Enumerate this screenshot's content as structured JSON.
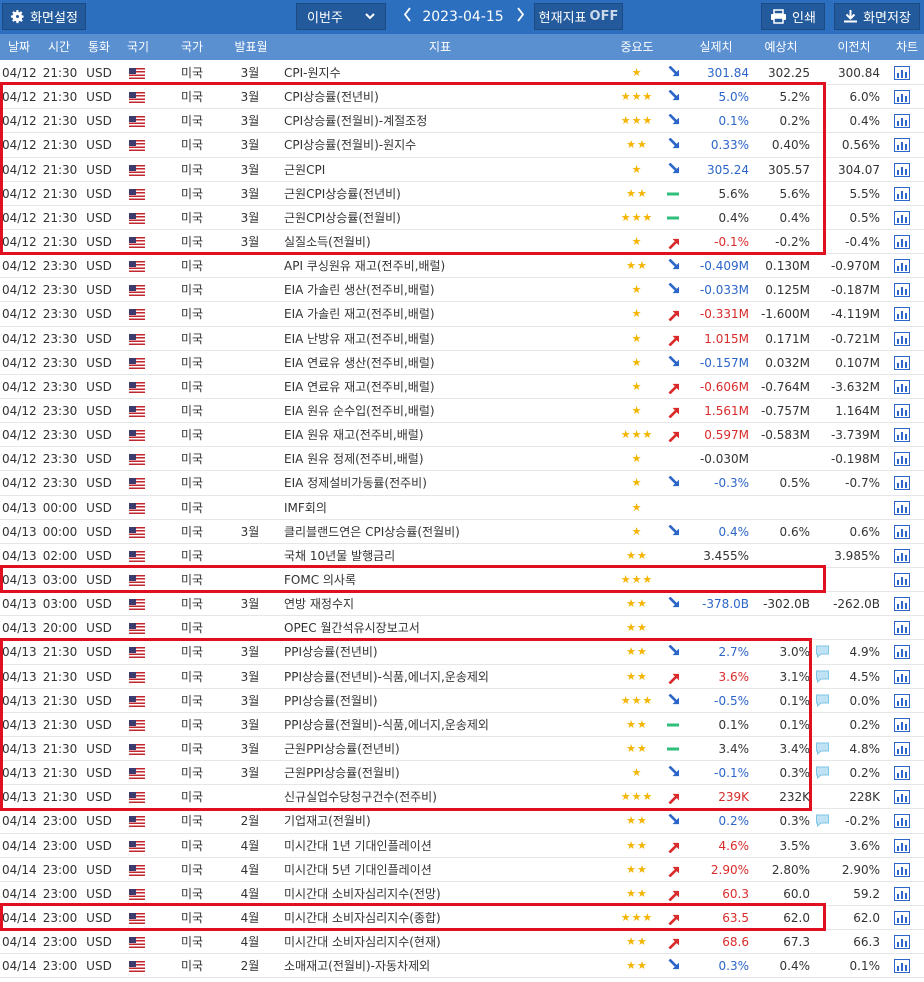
{
  "toolbar": {
    "settings_label": "화면설정",
    "week_select": "이번주",
    "date": "2023-04-15",
    "indicator_label": "현재지표",
    "indicator_state": "OFF",
    "print_label": "인쇄",
    "save_label": "화면저장"
  },
  "columns": [
    "날짜",
    "시간",
    "통화",
    "국기",
    "국가",
    "발표월",
    "지표",
    "중요도",
    "실제치",
    "예상치",
    "이전치",
    "차트"
  ],
  "colors": {
    "toolbar": "#2c6fbf",
    "header": "#5a8fd0",
    "up": "#d92b2b",
    "down": "#2c66c8",
    "flat": "#2fbf7a",
    "highlight": "#e01020",
    "star": "#f4b400"
  },
  "rows": [
    {
      "date": "04/12",
      "time": "21:30",
      "currency": "USD",
      "country": "미국",
      "month": "3월",
      "name": "CPI-원지수",
      "stars": "★",
      "trend": "down",
      "actual": "301.84",
      "actual_dir": "down",
      "forecast": "302.25",
      "previous": "300.84",
      "comment": false
    },
    {
      "date": "04/12",
      "time": "21:30",
      "currency": "USD",
      "country": "미국",
      "month": "3월",
      "name": "CPI상승률(전년비)",
      "stars": "★★★",
      "trend": "down",
      "actual": "5.0%",
      "actual_dir": "down",
      "forecast": "5.2%",
      "previous": "6.0%",
      "comment": false
    },
    {
      "date": "04/12",
      "time": "21:30",
      "currency": "USD",
      "country": "미국",
      "month": "3월",
      "name": "CPI상승률(전월비)-계절조정",
      "stars": "★★★",
      "trend": "down",
      "actual": "0.1%",
      "actual_dir": "down",
      "forecast": "0.2%",
      "previous": "0.4%",
      "comment": false
    },
    {
      "date": "04/12",
      "time": "21:30",
      "currency": "USD",
      "country": "미국",
      "month": "3월",
      "name": "CPI상승률(전월비)-원지수",
      "stars": "★★",
      "trend": "down",
      "actual": "0.33%",
      "actual_dir": "down",
      "forecast": "0.40%",
      "previous": "0.56%",
      "comment": false
    },
    {
      "date": "04/12",
      "time": "21:30",
      "currency": "USD",
      "country": "미국",
      "month": "3월",
      "name": "근원CPI",
      "stars": "★",
      "trend": "down",
      "actual": "305.24",
      "actual_dir": "down",
      "forecast": "305.57",
      "previous": "304.07",
      "comment": false
    },
    {
      "date": "04/12",
      "time": "21:30",
      "currency": "USD",
      "country": "미국",
      "month": "3월",
      "name": "근원CPI상승률(전년비)",
      "stars": "★★",
      "trend": "flat",
      "actual": "5.6%",
      "actual_dir": "flat",
      "forecast": "5.6%",
      "previous": "5.5%",
      "comment": false
    },
    {
      "date": "04/12",
      "time": "21:30",
      "currency": "USD",
      "country": "미국",
      "month": "3월",
      "name": "근원CPI상승률(전월비)",
      "stars": "★★★",
      "trend": "flat",
      "actual": "0.4%",
      "actual_dir": "flat",
      "forecast": "0.4%",
      "previous": "0.5%",
      "comment": false
    },
    {
      "date": "04/12",
      "time": "21:30",
      "currency": "USD",
      "country": "미국",
      "month": "3월",
      "name": "실질소득(전월비)",
      "stars": "★",
      "trend": "up",
      "actual": "-0.1%",
      "actual_dir": "up",
      "forecast": "-0.2%",
      "previous": "-0.4%",
      "comment": false
    },
    {
      "date": "04/12",
      "time": "23:30",
      "currency": "USD",
      "country": "미국",
      "month": "",
      "name": "API 쿠싱원유 재고(전주비,배럴)",
      "stars": "★★",
      "trend": "down",
      "actual": "-0.409M",
      "actual_dir": "down",
      "forecast": "0.130M",
      "previous": "-0.970M",
      "comment": false
    },
    {
      "date": "04/12",
      "time": "23:30",
      "currency": "USD",
      "country": "미국",
      "month": "",
      "name": "EIA 가솔린 생산(전주비,배럴)",
      "stars": "★",
      "trend": "down",
      "actual": "-0.033M",
      "actual_dir": "down",
      "forecast": "0.125M",
      "previous": "-0.187M",
      "comment": false
    },
    {
      "date": "04/12",
      "time": "23:30",
      "currency": "USD",
      "country": "미국",
      "month": "",
      "name": "EIA 가솔린 재고(전주비,배럴)",
      "stars": "★",
      "trend": "up",
      "actual": "-0.331M",
      "actual_dir": "up",
      "forecast": "-1.600M",
      "previous": "-4.119M",
      "comment": false
    },
    {
      "date": "04/12",
      "time": "23:30",
      "currency": "USD",
      "country": "미국",
      "month": "",
      "name": "EIA 난방유 재고(전주비,배럴)",
      "stars": "★",
      "trend": "up",
      "actual": "1.015M",
      "actual_dir": "up",
      "forecast": "0.171M",
      "previous": "-0.721M",
      "comment": false
    },
    {
      "date": "04/12",
      "time": "23:30",
      "currency": "USD",
      "country": "미국",
      "month": "",
      "name": "EIA 연료유 생산(전주비,배럴)",
      "stars": "★",
      "trend": "down",
      "actual": "-0.157M",
      "actual_dir": "down",
      "forecast": "0.032M",
      "previous": "0.107M",
      "comment": false
    },
    {
      "date": "04/12",
      "time": "23:30",
      "currency": "USD",
      "country": "미국",
      "month": "",
      "name": "EIA 연료유 재고(전주비,배럴)",
      "stars": "★",
      "trend": "up",
      "actual": "-0.606M",
      "actual_dir": "up",
      "forecast": "-0.764M",
      "previous": "-3.632M",
      "comment": false
    },
    {
      "date": "04/12",
      "time": "23:30",
      "currency": "USD",
      "country": "미국",
      "month": "",
      "name": "EIA 원유 순수입(전주비,배럴)",
      "stars": "★",
      "trend": "up",
      "actual": "1.561M",
      "actual_dir": "up",
      "forecast": "-0.757M",
      "previous": "1.164M",
      "comment": false
    },
    {
      "date": "04/12",
      "time": "23:30",
      "currency": "USD",
      "country": "미국",
      "month": "",
      "name": "EIA 원유 재고(전주비,배럴)",
      "stars": "★★★",
      "trend": "up",
      "actual": "0.597M",
      "actual_dir": "up",
      "forecast": "-0.583M",
      "previous": "-3.739M",
      "comment": false
    },
    {
      "date": "04/12",
      "time": "23:30",
      "currency": "USD",
      "country": "미국",
      "month": "",
      "name": "EIA 원유 정제(전주비,배럴)",
      "stars": "★",
      "trend": "",
      "actual": "-0.030M",
      "actual_dir": "flat",
      "forecast": "",
      "previous": "-0.198M",
      "comment": false
    },
    {
      "date": "04/12",
      "time": "23:30",
      "currency": "USD",
      "country": "미국",
      "month": "",
      "name": "EIA 정제설비가동률(전주비)",
      "stars": "★",
      "trend": "down",
      "actual": "-0.3%",
      "actual_dir": "down",
      "forecast": "0.5%",
      "previous": "-0.7%",
      "comment": false
    },
    {
      "date": "04/13",
      "time": "00:00",
      "currency": "USD",
      "country": "미국",
      "month": "",
      "name": "IMF회의",
      "stars": "★",
      "trend": "",
      "actual": "",
      "actual_dir": "flat",
      "forecast": "",
      "previous": "",
      "comment": false
    },
    {
      "date": "04/13",
      "time": "00:00",
      "currency": "USD",
      "country": "미국",
      "month": "3월",
      "name": "클리블랜드연은 CPI상승률(전월비)",
      "stars": "★",
      "trend": "down",
      "actual": "0.4%",
      "actual_dir": "down",
      "forecast": "0.6%",
      "previous": "0.6%",
      "comment": false
    },
    {
      "date": "04/13",
      "time": "02:00",
      "currency": "USD",
      "country": "미국",
      "month": "",
      "name": "국채 10년물 발행금리",
      "stars": "★★",
      "trend": "",
      "actual": "3.455%",
      "actual_dir": "flat",
      "forecast": "",
      "previous": "3.985%",
      "comment": false
    },
    {
      "date": "04/13",
      "time": "03:00",
      "currency": "USD",
      "country": "미국",
      "month": "",
      "name": "FOMC 의사록",
      "stars": "★★★",
      "trend": "",
      "actual": "",
      "actual_dir": "flat",
      "forecast": "",
      "previous": "",
      "comment": false
    },
    {
      "date": "04/13",
      "time": "03:00",
      "currency": "USD",
      "country": "미국",
      "month": "3월",
      "name": "연방 재정수지",
      "stars": "★★",
      "trend": "down",
      "actual": "-378.0B",
      "actual_dir": "down",
      "forecast": "-302.0B",
      "previous": "-262.0B",
      "comment": false
    },
    {
      "date": "04/13",
      "time": "20:00",
      "currency": "USD",
      "country": "미국",
      "month": "",
      "name": "OPEC 월간석유시장보고서",
      "stars": "★★",
      "trend": "",
      "actual": "",
      "actual_dir": "flat",
      "forecast": "",
      "previous": "",
      "comment": false
    },
    {
      "date": "04/13",
      "time": "21:30",
      "currency": "USD",
      "country": "미국",
      "month": "3월",
      "name": "PPI상승률(전년비)",
      "stars": "★★",
      "trend": "down",
      "actual": "2.7%",
      "actual_dir": "down",
      "forecast": "3.0%",
      "previous": "4.9%",
      "comment": true
    },
    {
      "date": "04/13",
      "time": "21:30",
      "currency": "USD",
      "country": "미국",
      "month": "3월",
      "name": "PPI상승률(전년비)-식품,에너지,운송제외",
      "stars": "★★",
      "trend": "up",
      "actual": "3.6%",
      "actual_dir": "up",
      "forecast": "3.1%",
      "previous": "4.5%",
      "comment": true
    },
    {
      "date": "04/13",
      "time": "21:30",
      "currency": "USD",
      "country": "미국",
      "month": "3월",
      "name": "PPI상승률(전월비)",
      "stars": "★★★",
      "trend": "down",
      "actual": "-0.5%",
      "actual_dir": "down",
      "forecast": "0.1%",
      "previous": "0.0%",
      "comment": true
    },
    {
      "date": "04/13",
      "time": "21:30",
      "currency": "USD",
      "country": "미국",
      "month": "3월",
      "name": "PPI상승률(전월비)-식품,에너지,운송제외",
      "stars": "★★",
      "trend": "flat",
      "actual": "0.1%",
      "actual_dir": "flat",
      "forecast": "0.1%",
      "previous": "0.2%",
      "comment": false
    },
    {
      "date": "04/13",
      "time": "21:30",
      "currency": "USD",
      "country": "미국",
      "month": "3월",
      "name": "근원PPI상승률(전년비)",
      "stars": "★★",
      "trend": "flat",
      "actual": "3.4%",
      "actual_dir": "flat",
      "forecast": "3.4%",
      "previous": "4.8%",
      "comment": true
    },
    {
      "date": "04/13",
      "time": "21:30",
      "currency": "USD",
      "country": "미국",
      "month": "3월",
      "name": "근원PPI상승률(전월비)",
      "stars": "★",
      "trend": "down",
      "actual": "-0.1%",
      "actual_dir": "down",
      "forecast": "0.3%",
      "previous": "0.2%",
      "comment": true
    },
    {
      "date": "04/13",
      "time": "21:30",
      "currency": "USD",
      "country": "미국",
      "month": "",
      "name": "신규실업수당청구건수(전주비)",
      "stars": "★★★",
      "trend": "up",
      "actual": "239K",
      "actual_dir": "up",
      "forecast": "232K",
      "previous": "228K",
      "comment": false
    },
    {
      "date": "04/14",
      "time": "23:00",
      "currency": "USD",
      "country": "미국",
      "month": "2월",
      "name": "기업재고(전월비)",
      "stars": "★★",
      "trend": "down",
      "actual": "0.2%",
      "actual_dir": "down",
      "forecast": "0.3%",
      "previous": "-0.2%",
      "comment": true
    },
    {
      "date": "04/14",
      "time": "23:00",
      "currency": "USD",
      "country": "미국",
      "month": "4월",
      "name": "미시간대 1년 기대인플레이션",
      "stars": "★★",
      "trend": "up",
      "actual": "4.6%",
      "actual_dir": "up",
      "forecast": "3.5%",
      "previous": "3.6%",
      "comment": false
    },
    {
      "date": "04/14",
      "time": "23:00",
      "currency": "USD",
      "country": "미국",
      "month": "4월",
      "name": "미시간대 5년 기대인플레이션",
      "stars": "★★",
      "trend": "up",
      "actual": "2.90%",
      "actual_dir": "up",
      "forecast": "2.80%",
      "previous": "2.90%",
      "comment": false
    },
    {
      "date": "04/14",
      "time": "23:00",
      "currency": "USD",
      "country": "미국",
      "month": "4월",
      "name": "미시간대 소비자심리지수(전망)",
      "stars": "★★",
      "trend": "up",
      "actual": "60.3",
      "actual_dir": "up",
      "forecast": "60.0",
      "previous": "59.2",
      "comment": false
    },
    {
      "date": "04/14",
      "time": "23:00",
      "currency": "USD",
      "country": "미국",
      "month": "4월",
      "name": "미시간대 소비자심리지수(종합)",
      "stars": "★★★",
      "trend": "up",
      "actual": "63.5",
      "actual_dir": "up",
      "forecast": "62.0",
      "previous": "62.0",
      "comment": false
    },
    {
      "date": "04/14",
      "time": "23:00",
      "currency": "USD",
      "country": "미국",
      "month": "4월",
      "name": "미시간대 소비자심리지수(현재)",
      "stars": "★★",
      "trend": "up",
      "actual": "68.6",
      "actual_dir": "up",
      "forecast": "67.3",
      "previous": "66.3",
      "comment": false
    },
    {
      "date": "04/14",
      "time": "23:00",
      "currency": "USD",
      "country": "미국",
      "month": "2월",
      "name": "소매재고(전월비)-자동차제외",
      "stars": "★★",
      "trend": "down",
      "actual": "0.3%",
      "actual_dir": "down",
      "forecast": "0.4%",
      "previous": "0.1%",
      "comment": false
    }
  ],
  "highlight_groups": [
    {
      "first_row": 1,
      "last_row": 7,
      "right_col": "forecast"
    },
    {
      "first_row": 21,
      "last_row": 21,
      "right_col": "forecast"
    },
    {
      "first_row": 24,
      "last_row": 30,
      "right_col": "forecast"
    },
    {
      "first_row": 35,
      "last_row": 35,
      "right_col": "forecast"
    }
  ]
}
